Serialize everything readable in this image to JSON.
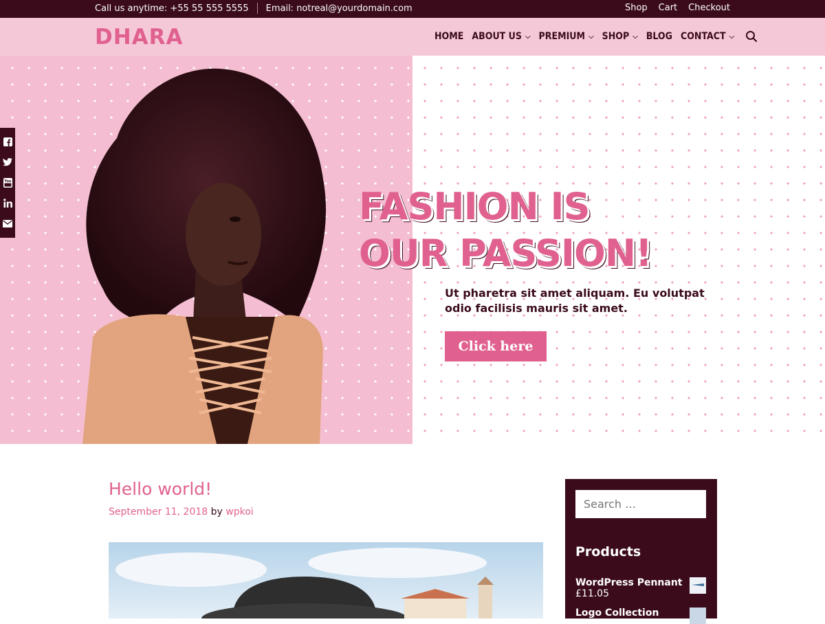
{
  "topbar": {
    "phone": "Call us anytime: +55 55 555 5555",
    "email": "Email: notreal@yourdomain.com",
    "links": [
      "Shop",
      "Cart",
      "Checkout"
    ]
  },
  "header": {
    "logo": "DHARA",
    "nav": [
      {
        "label": "HOME",
        "dropdown": false
      },
      {
        "label": "ABOUT US",
        "dropdown": true
      },
      {
        "label": "PREMIUM",
        "dropdown": true
      },
      {
        "label": "SHOP",
        "dropdown": true
      },
      {
        "label": "BLOG",
        "dropdown": false
      },
      {
        "label": "CONTACT",
        "dropdown": true
      }
    ]
  },
  "hero": {
    "title_line1": "FASHION IS",
    "title_line2": "OUR PASSION!",
    "text": "Ut pharetra sit amet aliquam. Eu volutpat odio facilisis mauris sit amet.",
    "button": "Click here"
  },
  "social": [
    "facebook-icon",
    "twitter-icon",
    "youtube-icon",
    "linkedin-icon",
    "envelope-icon"
  ],
  "post": {
    "title": "Hello world!",
    "date": "September 11, 2018",
    "by": "by",
    "author": "wpkoi"
  },
  "sidebar": {
    "search_placeholder": "Search …",
    "widget_title": "Products",
    "products": [
      {
        "name": "WordPress Pennant",
        "price": "£11.05"
      },
      {
        "name": "Logo Collection",
        "price": ""
      }
    ]
  },
  "colors": {
    "accent": "#e0618f",
    "dark": "#3b0b1c",
    "header_bg": "#f5c8d8"
  }
}
